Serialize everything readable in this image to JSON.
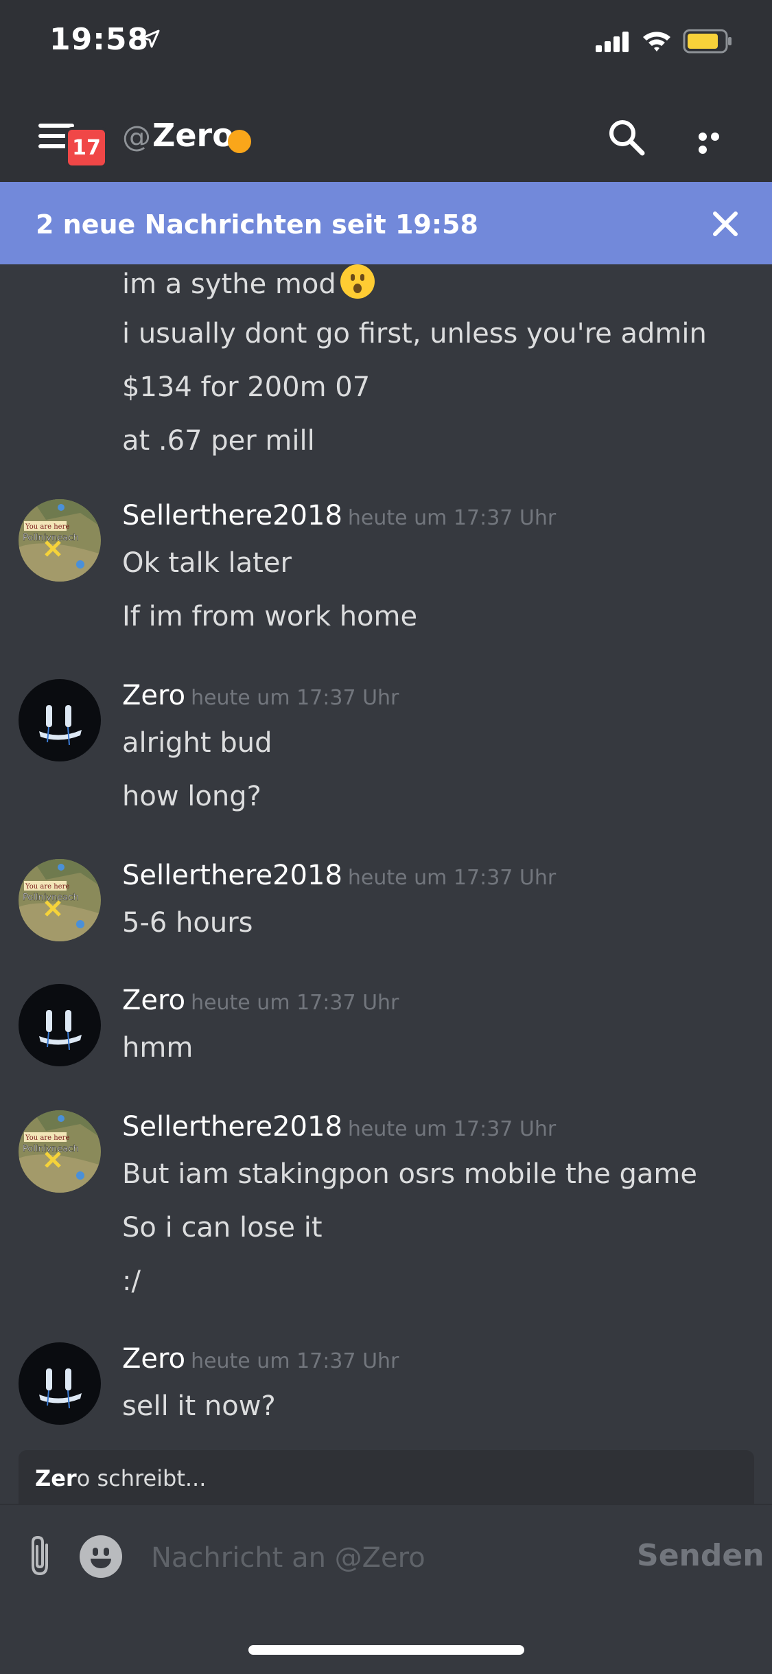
{
  "status_bar": {
    "time": "19:58"
  },
  "header": {
    "badge_count": "17",
    "at_symbol": "@",
    "channel_name": "Zero",
    "status_color": "#faa61a"
  },
  "banner": {
    "text": "2 neue Nachrichten seit 19:58"
  },
  "colors": {
    "background": "#36393f",
    "header": "#2f3136",
    "banner": "#7289da",
    "badge": "#f04747",
    "idle": "#faa61a"
  },
  "messages": {
    "m0": {
      "lines": [
        "im a sythe mod",
        "i usually dont go first, unless you're admin",
        "$134 for 200m 07",
        "at .67 per mill"
      ]
    },
    "m1": {
      "author": "Sellerthere2018",
      "timestamp": "heute um 17:37 Uhr",
      "lines": [
        "Ok talk later",
        "If im from work home"
      ]
    },
    "m2": {
      "author": "Zero",
      "timestamp": "heute um 17:37 Uhr",
      "lines": [
        "alright bud",
        "how long?"
      ]
    },
    "m3": {
      "author": "Sellerthere2018",
      "timestamp": "heute um 17:37 Uhr",
      "lines": [
        "5-6 hours"
      ]
    },
    "m4": {
      "author": "Zero",
      "timestamp": "heute um 17:37 Uhr",
      "lines": [
        "hmm"
      ]
    },
    "m5": {
      "author": "Sellerthere2018",
      "timestamp": "heute um 17:37 Uhr",
      "lines": [
        "But iam stakingpon osrs mobile the game",
        "So i can lose it",
        ":/"
      ]
    },
    "m6": {
      "author": "Zero",
      "timestamp": "heute um 17:37 Uhr",
      "lines": [
        "sell it now?"
      ]
    }
  },
  "avatar_text": {
    "you_are_here": "You are here",
    "map_label": "Pollnivneach"
  },
  "typing": {
    "name_bold": "Zer",
    "name_rest": "o",
    "suffix": " schreibt..."
  },
  "composer": {
    "placeholder": "Nachricht an @Zero",
    "send_label": "Senden"
  }
}
